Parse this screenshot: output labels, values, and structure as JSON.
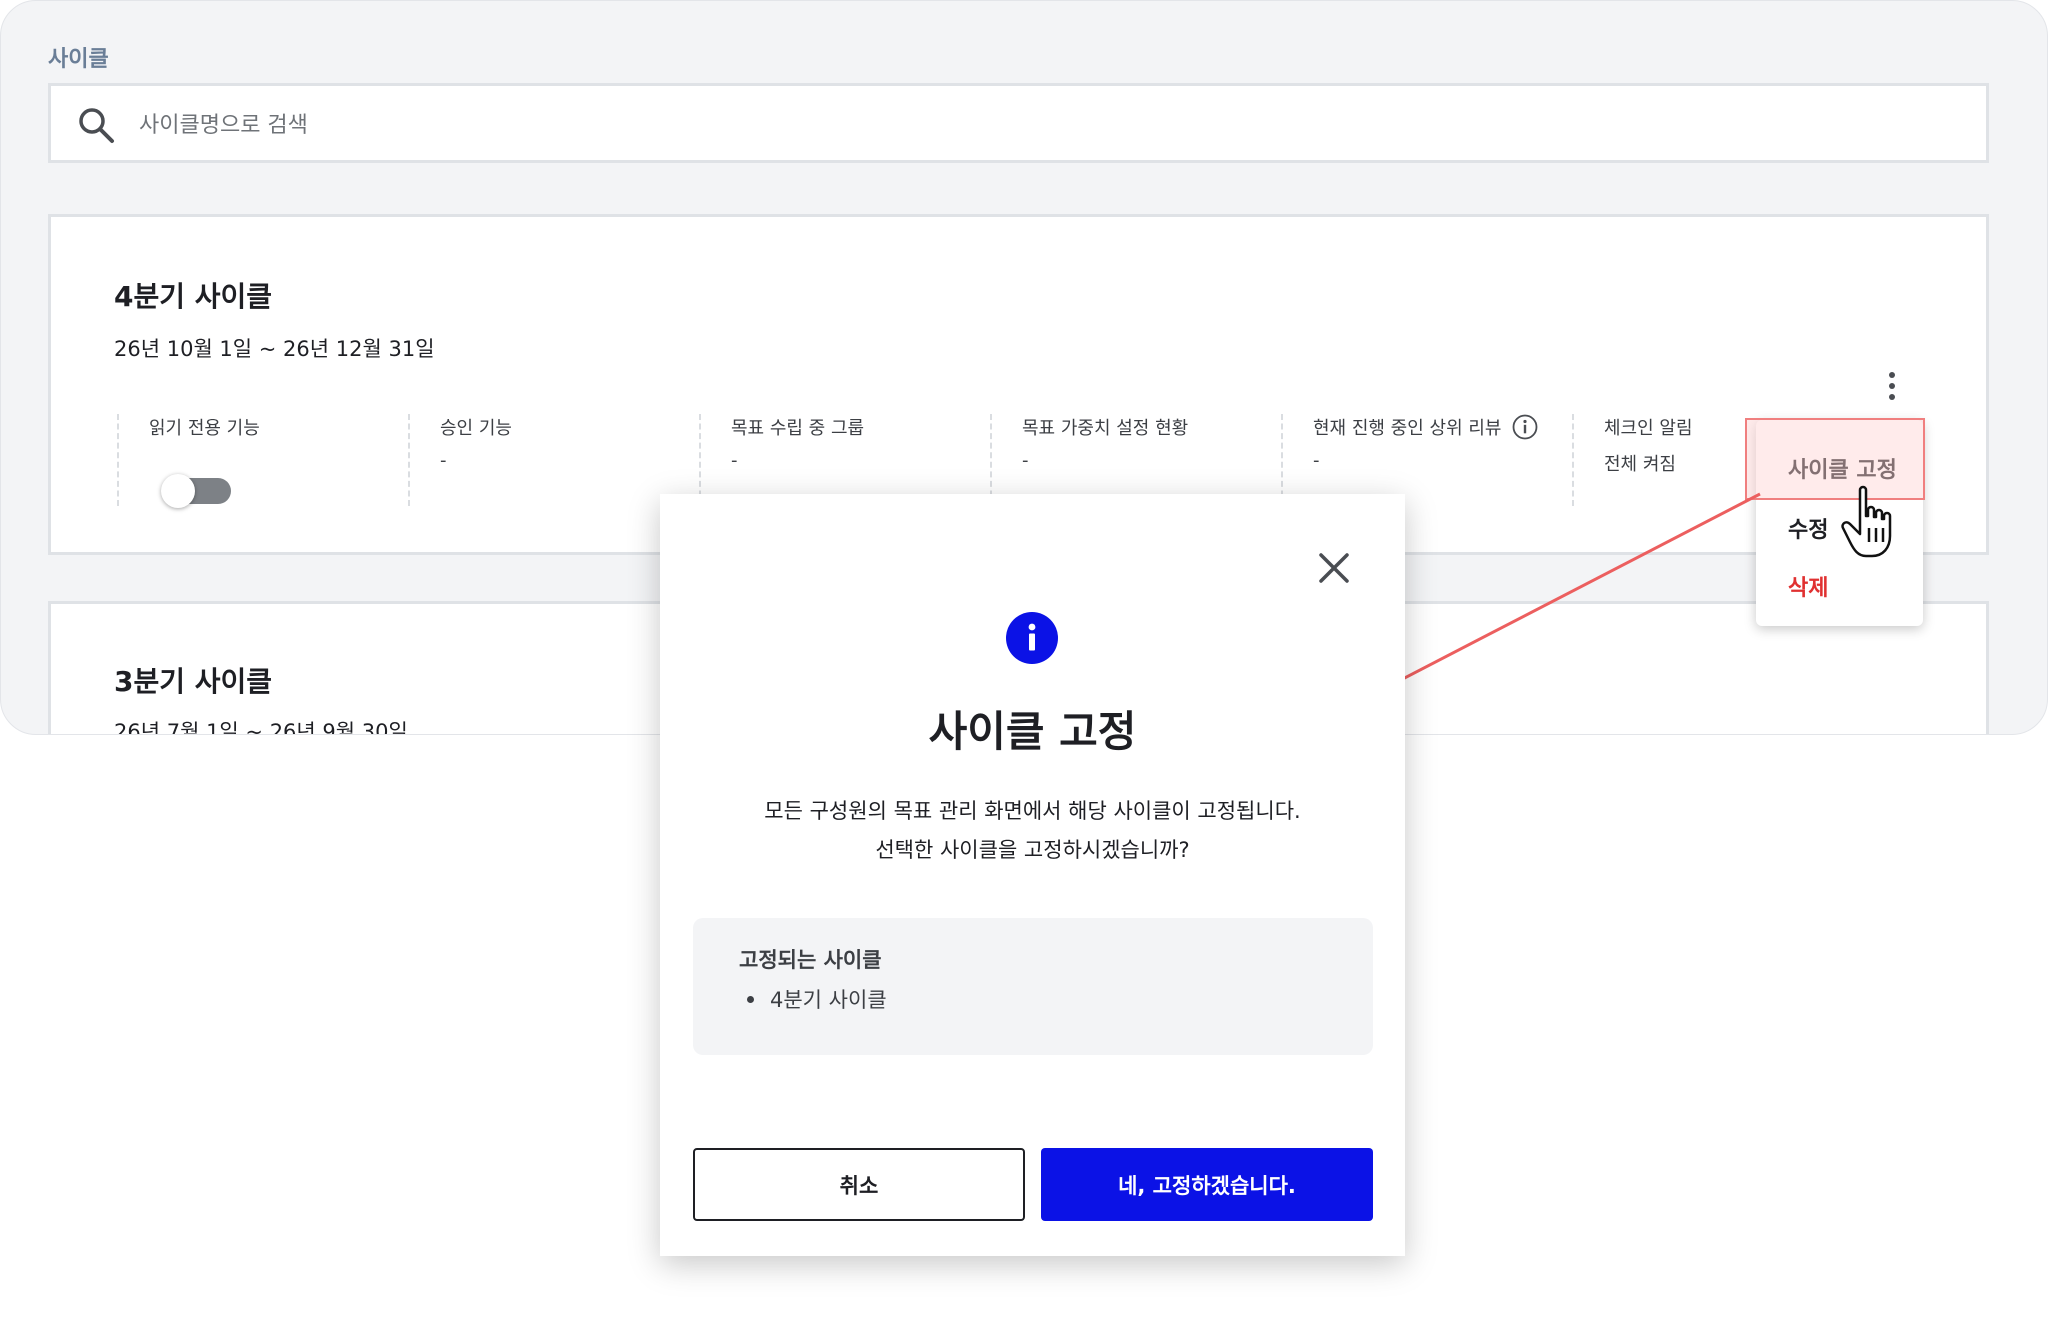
{
  "section": {
    "label": "사이클"
  },
  "search": {
    "placeholder": "사이클명으로 검색"
  },
  "cycles": [
    {
      "title": "4분기 사이클",
      "date_range": "26년 10월 1일 ~ 26년 12월 31일",
      "stats": [
        {
          "label": "읽기 전용 기능",
          "value": "",
          "toggle_on": false
        },
        {
          "label": "승인 기능",
          "value": "-"
        },
        {
          "label": "목표 수립 중 그룹",
          "value": "-"
        },
        {
          "label": "목표 가중치 설정 현황",
          "value": "-"
        },
        {
          "label": "현재 진행 중인 상위 리뷰",
          "value": "-"
        },
        {
          "label": "체크인 알림",
          "value": "전체 켜짐"
        }
      ]
    },
    {
      "title": "3분기 사이클",
      "date_range": "26년 7월 1일 ~ 26년 9월 30일"
    }
  ],
  "context_menu": {
    "items": {
      "pin": "사이클 고정",
      "edit": "수정",
      "delete": "삭제"
    }
  },
  "modal": {
    "title": "사이클 고정",
    "description_line1": "모든 구성원의 목표 관리 화면에서 해당 사이클이 고정됩니다.",
    "description_line2": "선택한 사이클을 고정하시겠습니까?",
    "box_title": "고정되는 사이클",
    "box_item": "4분기 사이클",
    "cancel_label": "취소",
    "confirm_label": "네, 고정하겠습니다."
  },
  "colors": {
    "accent": "#0b12e6",
    "danger": "#e03131",
    "annotation": "#ec5f5f",
    "section_label": "#6a7e97"
  }
}
